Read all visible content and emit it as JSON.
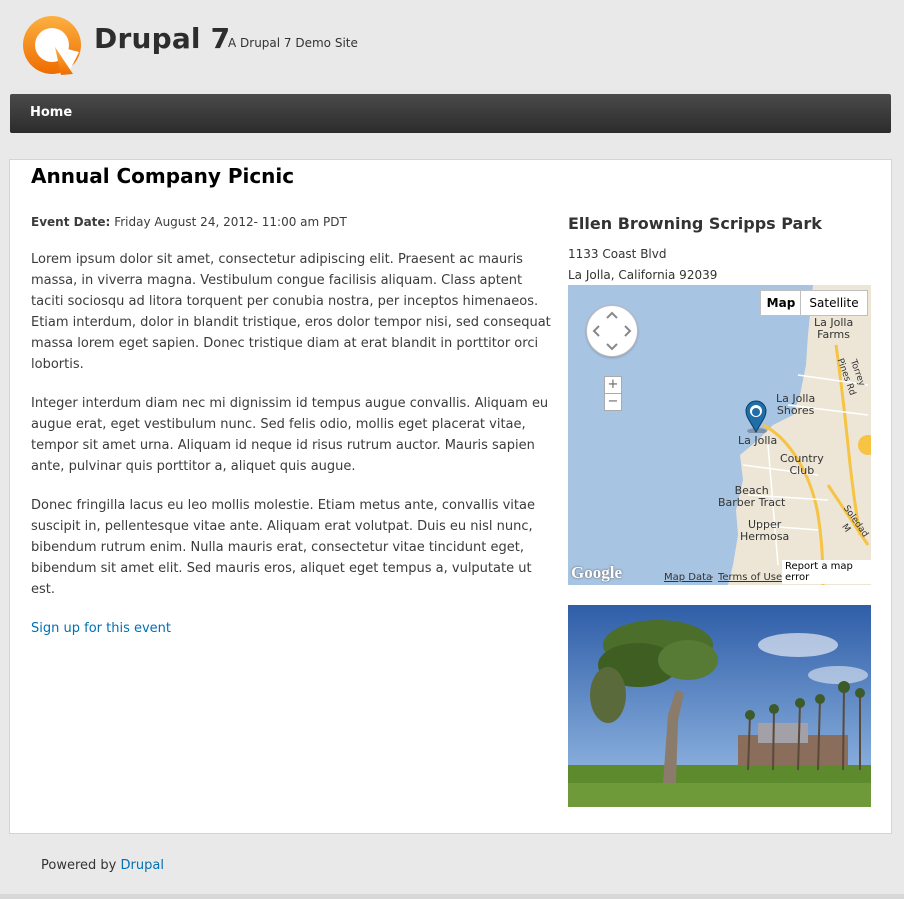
{
  "header": {
    "site_name": "Drupal 7",
    "slogan": "A Drupal 7 Demo Site",
    "logo_icon": "drupal-logo-icon",
    "logo_color": "#f39200"
  },
  "nav": {
    "items": [
      {
        "label": "Home"
      }
    ]
  },
  "page": {
    "title": "Annual Company Picnic",
    "event_date_label": "Event Date:",
    "event_date_value": "Friday August 24, 2012- 11:00 am PDT",
    "paragraphs": [
      "Lorem ipsum dolor sit amet, consectetur adipiscing elit. Praesent ac mauris massa, in viverra magna. Vestibulum congue facilisis aliquam. Class aptent taciti sociosqu ad litora torquent per conubia nostra, per inceptos himenaeos. Etiam interdum, dolor in blandit tristique, eros dolor tempor nisi, sed consequat massa lorem eget sapien. Donec tristique diam at erat blandit in porttitor orci lobortis.",
      "Integer interdum diam nec mi dignissim id tempus augue convallis. Aliquam eu augue erat, eget vestibulum nunc. Sed felis odio, mollis eget placerat vitae, tempor sit amet urna. Aliquam id neque id risus rutrum auctor. Mauris sapien ante, pulvinar quis porttitor a, aliquet quis augue.",
      "Donec fringilla lacus eu leo mollis molestie. Etiam metus ante, convallis vitae suscipit in, pellentesque vitae ante. Aliquam erat volutpat. Duis eu nisl nunc, bibendum rutrum enim. Nulla mauris erat, consectetur vitae tincidunt eget, bibendum sit amet elit. Sed mauris eros, aliquet eget tempus a, vulputate ut est."
    ],
    "signup_link": "Sign up for this event"
  },
  "venue": {
    "name": "Ellen Browning Scripps Park",
    "address_line1": "1133 Coast Blvd",
    "address_line2": "La Jolla, California 92039"
  },
  "map": {
    "btn_map": "Map",
    "btn_satellite": "Satellite",
    "zoom_in": "+",
    "zoom_out": "−",
    "labels": {
      "la_jolla_farms": "La Jolla\nFarms",
      "la_jolla_shores": "La Jolla\nShores",
      "la_jolla": "La Jolla",
      "country_club": "Country\nClub",
      "beach_barber_tract": "Beach\nBarber Tract",
      "upper_hermosa": "Upper\nHermosa",
      "torrey_pines_rd": "Torrey Pines Rd",
      "soledad": "Soledad M"
    },
    "google": "Google",
    "map_data": "Map Data",
    "separator": "-",
    "terms": "Terms of Use",
    "report": "Report a map error",
    "water_color": "#a8c4e3",
    "land_color": "#ede6d6",
    "marker_color": "#1f6ea8"
  },
  "footer": {
    "powered_by": "Powered by",
    "drupal_link": "Drupal"
  }
}
